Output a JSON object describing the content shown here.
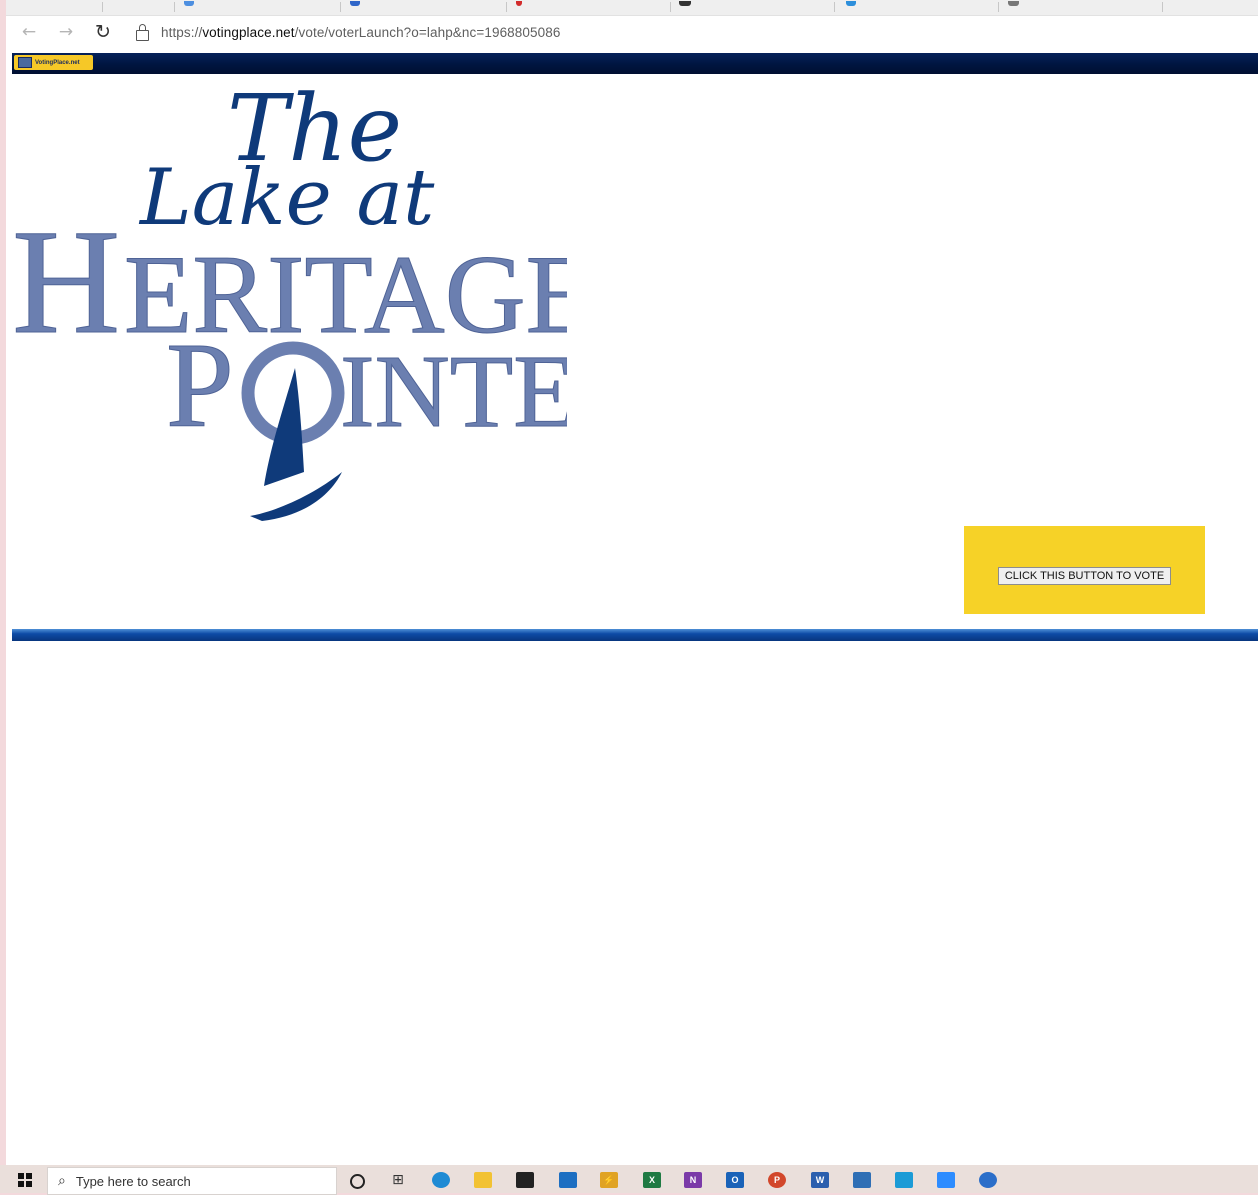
{
  "browser": {
    "url_scheme": "https://",
    "url_host": "votingplace.net",
    "url_path": "/vote/voterLaunch?o=lahp&nc=1968805086",
    "back_glyph": "←",
    "forward_glyph": "→",
    "reload_glyph": "↻"
  },
  "page": {
    "brand_badge": "VotingPlace.net",
    "logo": {
      "line1": "The",
      "line2": "Lake at",
      "line3_initial": "H",
      "line3_rest": "ERITAGE",
      "line4_initial": "P",
      "line4_rest": "INTE"
    },
    "vote_button_label": "CLICK THIS BUTTON TO VOTE"
  },
  "taskbar": {
    "search_placeholder": "Type here to search",
    "search_glyph": "⌕",
    "apps": [
      {
        "name": "cortana-icon"
      },
      {
        "name": "task-view-icon",
        "glyph": "⊞"
      },
      {
        "name": "edge-icon",
        "color": "#1f8bd4"
      },
      {
        "name": "file-explorer-icon",
        "color": "#f2c232"
      },
      {
        "name": "store-icon",
        "color": "#222222"
      },
      {
        "name": "mail-icon",
        "color": "#1d6fc2"
      },
      {
        "name": "power-automate-icon",
        "color": "#e0a324",
        "glyph": "⚡"
      },
      {
        "name": "excel-icon",
        "color": "#1f7a43",
        "glyph": "X"
      },
      {
        "name": "onenote-icon",
        "color": "#7b3aa8",
        "glyph": "N"
      },
      {
        "name": "outlook-icon",
        "color": "#1a62b8",
        "glyph": "O"
      },
      {
        "name": "powerpoint-icon",
        "color": "#d2472b",
        "glyph": "P"
      },
      {
        "name": "word-icon",
        "color": "#2b5fae",
        "glyph": "W"
      },
      {
        "name": "photos-icon",
        "color": "#2f6fb5"
      },
      {
        "name": "remote-desktop-icon",
        "color": "#1b9bd6"
      },
      {
        "name": "zoom-icon",
        "color": "#2d8cff"
      },
      {
        "name": "app-circle-icon",
        "color": "#2b6ec9"
      }
    ]
  },
  "colors": {
    "logo_blue_gray": "#6b7fb0",
    "logo_navy": "#0f3a7a",
    "vote_panel": "#f6d227",
    "top_bar": "#001540",
    "bottom_rule": "#0d4ba6"
  }
}
